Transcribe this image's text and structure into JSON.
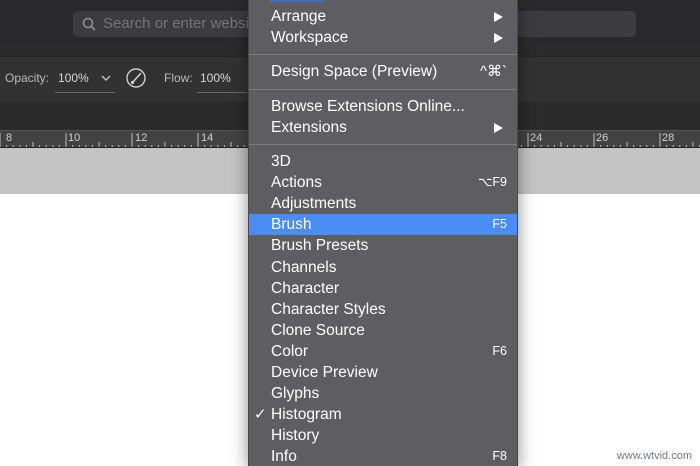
{
  "address_bar": {
    "placeholder": "Search or enter website name"
  },
  "options_bar": {
    "opacity_label": "Opacity:",
    "opacity_value": "100%",
    "flow_label": "Flow:",
    "flow_value": "100%"
  },
  "ruler": {
    "left_ticks": [
      "8",
      "10",
      "12",
      "14"
    ],
    "right_ticks": [
      "24",
      "26",
      "28"
    ]
  },
  "menu": {
    "items_top": [
      {
        "label": "Arrange",
        "submenu": true
      },
      {
        "label": "Workspace",
        "submenu": true
      }
    ],
    "design_space": {
      "label": "Design Space (Preview)",
      "shortcut": "^⌘`"
    },
    "extensions_group": [
      {
        "label": "Browse Extensions Online...",
        "submenu": false
      },
      {
        "label": "Extensions",
        "submenu": true
      }
    ],
    "panels": [
      {
        "label": "3D",
        "shortcut": "",
        "checked": false,
        "highlighted": false
      },
      {
        "label": "Actions",
        "shortcut": "⌥F9",
        "checked": false,
        "highlighted": false
      },
      {
        "label": "Adjustments",
        "shortcut": "",
        "checked": false,
        "highlighted": false
      },
      {
        "label": "Brush",
        "shortcut": "F5",
        "checked": false,
        "highlighted": true
      },
      {
        "label": "Brush Presets",
        "shortcut": "",
        "checked": false,
        "highlighted": false
      },
      {
        "label": "Channels",
        "shortcut": "",
        "checked": false,
        "highlighted": false
      },
      {
        "label": "Character",
        "shortcut": "",
        "checked": false,
        "highlighted": false
      },
      {
        "label": "Character Styles",
        "shortcut": "",
        "checked": false,
        "highlighted": false
      },
      {
        "label": "Clone Source",
        "shortcut": "",
        "checked": false,
        "highlighted": false
      },
      {
        "label": "Color",
        "shortcut": "F6",
        "checked": false,
        "highlighted": false
      },
      {
        "label": "Device Preview",
        "shortcut": "",
        "checked": false,
        "highlighted": false
      },
      {
        "label": "Glyphs",
        "shortcut": "",
        "checked": false,
        "highlighted": false
      },
      {
        "label": "Histogram",
        "shortcut": "",
        "checked": true,
        "highlighted": false
      },
      {
        "label": "History",
        "shortcut": "",
        "checked": false,
        "highlighted": false
      },
      {
        "label": "Info",
        "shortcut": "F8",
        "checked": false,
        "highlighted": false
      }
    ],
    "check_glyph": "✓"
  },
  "watermark": "www.wtvid.com",
  "colors": {
    "menu_bg": "#5e5e62",
    "highlight": "#4a8ef5",
    "canvas": "#ffffff",
    "pasteboard": "#c4c4c4"
  }
}
